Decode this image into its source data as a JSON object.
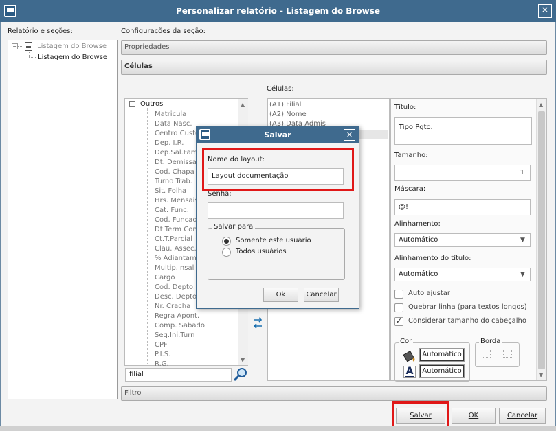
{
  "window": {
    "title": "Personalizar relatório - Listagem do Browse",
    "close": "✕"
  },
  "left": {
    "label": "Relatório e seções:",
    "tree": {
      "root": "Listagem do Browse",
      "child": "Listagem do Browse"
    }
  },
  "config": {
    "label": "Configurações da seção:",
    "propriedades": "Propriedades",
    "celulas_tab": "Células",
    "celulas_label": "Células:"
  },
  "fields": {
    "group": "Outros",
    "items": [
      "Matricula",
      "Data Nasc.",
      "Centro Custo",
      "Dep. I.R.",
      "Dep.Sal.Fam",
      "Dt. Demissao",
      "Cod. Chapa",
      "Turno Trab.",
      "Sit. Folha",
      "Hrs. Mensais",
      "Cat. Func.",
      "Cod. Funcao",
      "Dt Term Cont",
      "Ct.T.Parcial",
      "Clau. Assec.",
      "% Adiantam.",
      "Multip.Insal",
      "Cargo",
      "Cod. Depto.",
      "Desc. Depto",
      "Nr. Cracha",
      "Regra Apont.",
      "Comp. Sabado",
      "Seq.Ini.Turn",
      "CPF",
      "P.I.S.",
      "R.G."
    ],
    "search_value": "filial"
  },
  "cells": [
    "(A1) Filial",
    "(A2) Nome",
    "(A3) Data Admis"
  ],
  "props": {
    "titulo_label": "Título:",
    "titulo_value": "Tipo Pgto.",
    "tamanho_label": "Tamanho:",
    "tamanho_value": "1",
    "mascara_label": "Máscara:",
    "mascara_value": "@!",
    "alinhamento_label": "Alinhamento:",
    "alinhamento_value": "Automático",
    "alinhamento_titulo_label": "Alinhamento do título:",
    "alinhamento_titulo_value": "Automático",
    "auto_ajustar": "Auto ajustar",
    "quebrar_linha": "Quebrar linha (para textos longos)",
    "considerar": "Considerar tamanho do cabeçalho",
    "considerar_checked": true,
    "cor_label": "Cor",
    "cor1": "Automático",
    "cor2": "Automático",
    "borda_label": "Borda"
  },
  "filtro": "Filtro",
  "footer": {
    "salvar": "Salvar",
    "ok": "OK",
    "cancelar": "Cancelar"
  },
  "dialog": {
    "title": "Salvar",
    "close": "✕",
    "nome_label": "Nome do layout:",
    "nome_value": "Layout documentação",
    "senha_label": "Senha:",
    "salvar_para": "Salvar para",
    "opt1": "Somente este usuário",
    "opt2": "Todos usuários",
    "selected": "opt1",
    "ok": "Ok",
    "cancelar": "Cancelar"
  },
  "colors": {
    "titlebar": "#3f6a8e",
    "highlight": "#e01818"
  }
}
